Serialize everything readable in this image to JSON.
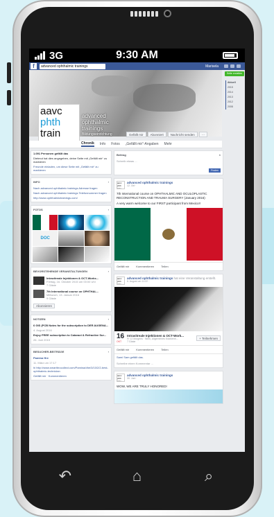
{
  "status": {
    "network": "3G",
    "time": "9:30 AM"
  },
  "fb": {
    "search": "advanced ophthalmic trainings",
    "user": "Marisela"
  },
  "cover": {
    "profile_lines": [
      "aavc",
      "phth",
      "train"
    ],
    "title_lines": [
      "advanced",
      "ophthalmic",
      "trainings"
    ],
    "subtitle": "Bildungseinrichtung",
    "buttons": [
      "Gefällt mir",
      "Abonniert",
      "Nachricht senden",
      "···"
    ]
  },
  "tabs": [
    "Chronik",
    "Info",
    "Fotos",
    "„Gefällt mir“-Angaben",
    "Mehr"
  ],
  "rightcol": {
    "create": "Seite erstellen",
    "years": [
      "Aktuell",
      "2015",
      "2014",
      "2013",
      "2012",
      "2008"
    ]
  },
  "left": {
    "likes_title": "1.091 Personen gefällt das",
    "likes_text": "Dietmut hat dies angegeben, deine Seite mit „Gefällt mir“ zu markieren",
    "invite": "Freunde einladen, um diese Seite mit „Gefällt mir“ zu markieren",
    "info_header": "INFO",
    "info_lines": [
      "Nach advanced ophthalmic trainings Adresse fragen",
      "Nach advanced ophthalmic trainings Telefonnummer fragen",
      "http://www.ophthalmictrainings.com/"
    ],
    "photos_header": "FOTOS",
    "events_header": "BEVORSTEHENDE VERANSTALTUNGEN",
    "events": [
      {
        "title": "Intravitreale Injektionen & OCT-Works...",
        "date": "Freitag, 16. Oktober 2015 um 00:00 Uhr",
        "meta": "7 Gäste"
      },
      {
        "title": "7th International course on OPHTHAL...",
        "date": "Mittwoch, 13. Januar 2016",
        "meta": "9 Gäste"
      }
    ],
    "subscribe": "Abonnieren",
    "notes_header": "NOTIZEN",
    "notes": [
      {
        "title": "6 GIS (PCB Notes for the subscription to DER AUGENA...",
        "date": "4. August 2016"
      },
      {
        "title": "Enjoy FREE subscription to Cataract & Refractive Sur...",
        "date": "26. Juni 2015"
      }
    ],
    "visitor_header": "BESUCHER-BEITRÄGE",
    "visitor_name": "Pamina Hre",
    "visitor_date": "11. März um 17:17",
    "visitor_text": "hi http://www.smartbrocollect.com/Pamina/dhe/3/10/2/2-best-ophthalmic-technician",
    "visitor_actions": "Gefällt mir · Kommentieren"
  },
  "composer": {
    "header": "Beitrag",
    "placeholder": "Schreib etwas ...",
    "post": "Posten"
  },
  "posts": [
    {
      "author": "advanced ophthalmic trainings",
      "meta": "12. Oct ·",
      "text1": "7th International course on OPHTHALMIC AND OCULOPLASTIC RECONSTRUCTION AND TRAUMA SURGERY (January 2016)",
      "text2": "A very warm welcome to our FIRST participant from Mexico!!"
    },
    {
      "author": "advanced ophthalmic trainings",
      "extra": "hat eine Veranstaltung erstellt.",
      "meta": "6. August um 11:22 ·",
      "day": "16",
      "month": "OKT",
      "event_title": "Intravitreale Injektionen & OCT-Work...",
      "event_meta": "Fr 12 Morgens · Wien, Allgemeines Krankenh...",
      "event_guests": "7 Gäste",
      "event_btn": "+ Teilnehmen"
    },
    {
      "author": "advanced ophthalmic trainings",
      "meta": "30. Juni ·",
      "text1": "WOW, WE ARE TRULY HONORED!"
    }
  ],
  "actions": [
    "Gefällt mir",
    "Kommentieren",
    "Teilen"
  ],
  "likes_line": "Sami Sam gefällt das.",
  "comment_placeholder": "Schreibe einen Kommentar ...",
  "colors": {
    "fb_blue": "#3b5998",
    "mexico_green": "#006847",
    "mexico_red": "#ce1126"
  }
}
